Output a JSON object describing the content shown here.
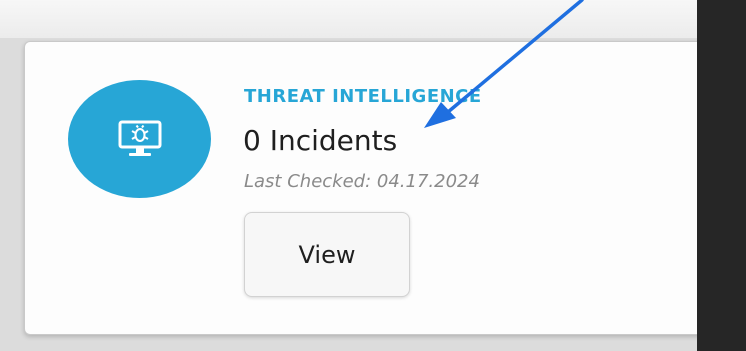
{
  "card": {
    "category": "THREAT INTELLIGENCE",
    "headline": "0 Incidents",
    "last_checked": "Last Checked: 04.17.2024",
    "view_label": "View",
    "icon": "bug-monitor-icon"
  },
  "colors": {
    "accent": "#27a6d6",
    "annotation_arrow": "#1f6fe0",
    "text_primary": "#1f1f1f",
    "text_muted": "#8a8a8a"
  },
  "annotation": {
    "icon": "arrow-annotation-icon"
  }
}
